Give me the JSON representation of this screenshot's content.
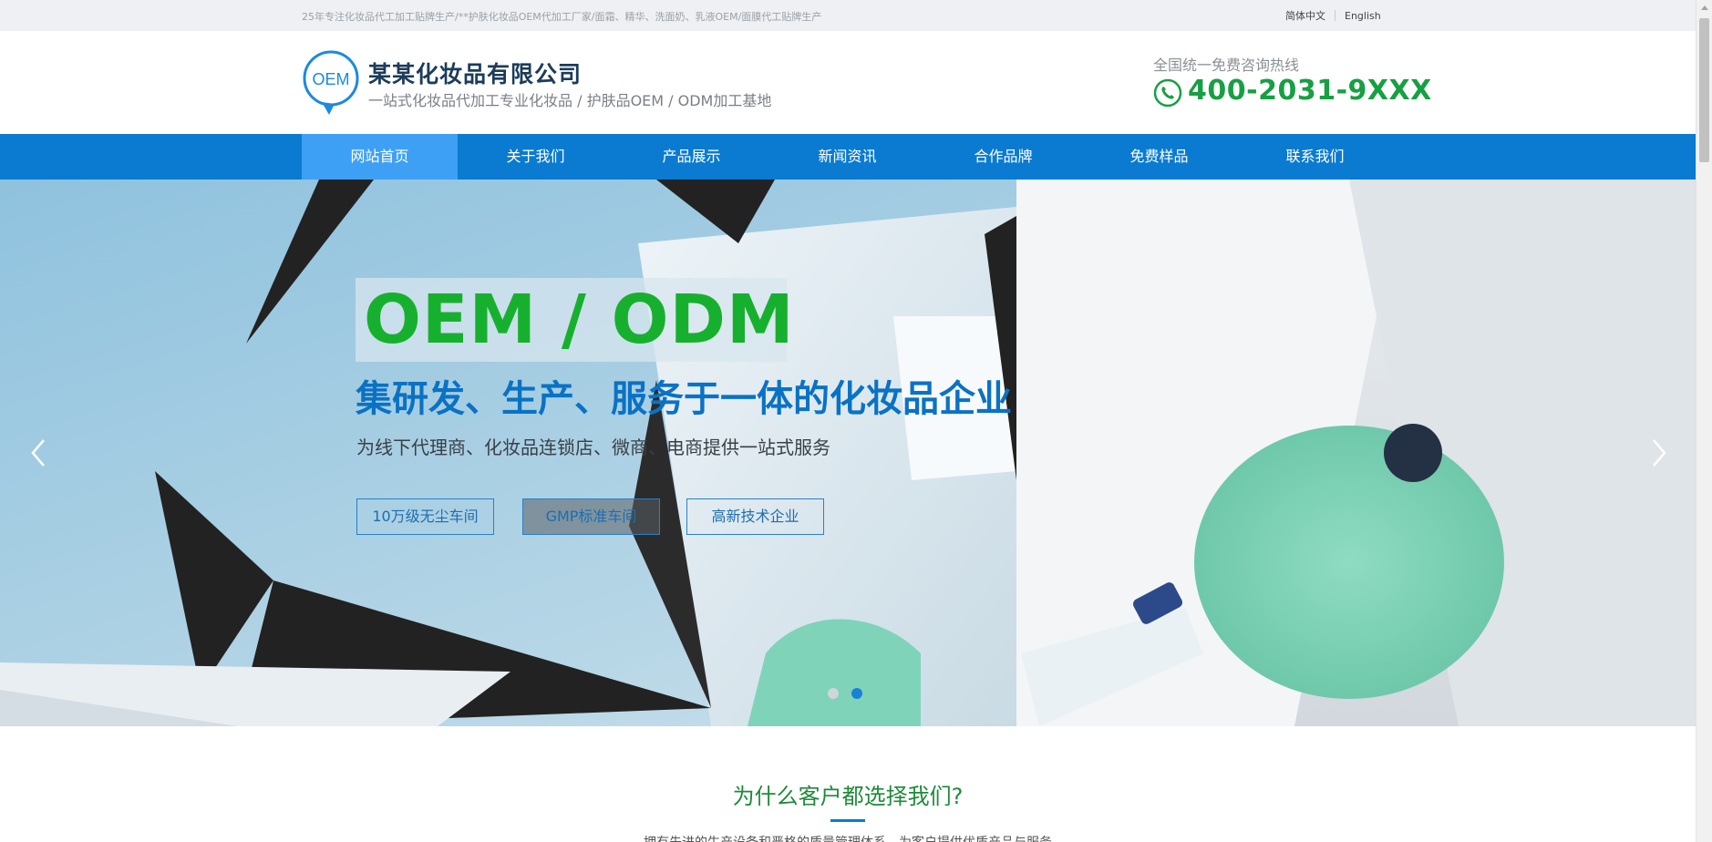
{
  "topbar": {
    "slogan": "25年专注化妆品代工加工贴牌生产/**护肤化妆品OEM代加工厂家/面霜、精华、洗面奶、乳液OEM/面膜代工贴牌生产",
    "lang_cn": "简体中文",
    "lang_en": "English"
  },
  "header": {
    "logo_text": "OEM",
    "company_name": "某某化妆品有限公司",
    "tagline": "一站式化妆品代加工专业化妆品 / 护肤品OEM / ODM加工基地",
    "hotline_label": "全国统一免费咨询热线",
    "hotline_number": "400-2031-9XXX"
  },
  "nav": {
    "items": [
      {
        "label": "网站首页",
        "active": true
      },
      {
        "label": "关于我们"
      },
      {
        "label": "产品展示"
      },
      {
        "label": "新闻资讯"
      },
      {
        "label": "合作品牌"
      },
      {
        "label": "免费样品"
      },
      {
        "label": "联系我们"
      }
    ]
  },
  "hero": {
    "title": "OEM / ODM",
    "subtitle": "集研发、生产、服务于一体的化妆品企业",
    "description": "为线下代理商、化妆品连锁店、微商、电商提供一站式服务",
    "tags": [
      "10万级无尘车间",
      "GMP标准车间",
      "高新技术企业"
    ],
    "slide_count": 2,
    "active_slide": 2
  },
  "why": {
    "title": "为什么客户都选择我们?",
    "description": "拥有先进的生产设备和严格的质量管理体系，为客户提供优质产品与服务"
  },
  "colors": {
    "nav_bg": "#0a7bd0",
    "nav_active": "#3ea0f5",
    "hotline": "#17a043",
    "hero_title": "#17b02e",
    "hero_subtitle": "#0a72c4"
  }
}
